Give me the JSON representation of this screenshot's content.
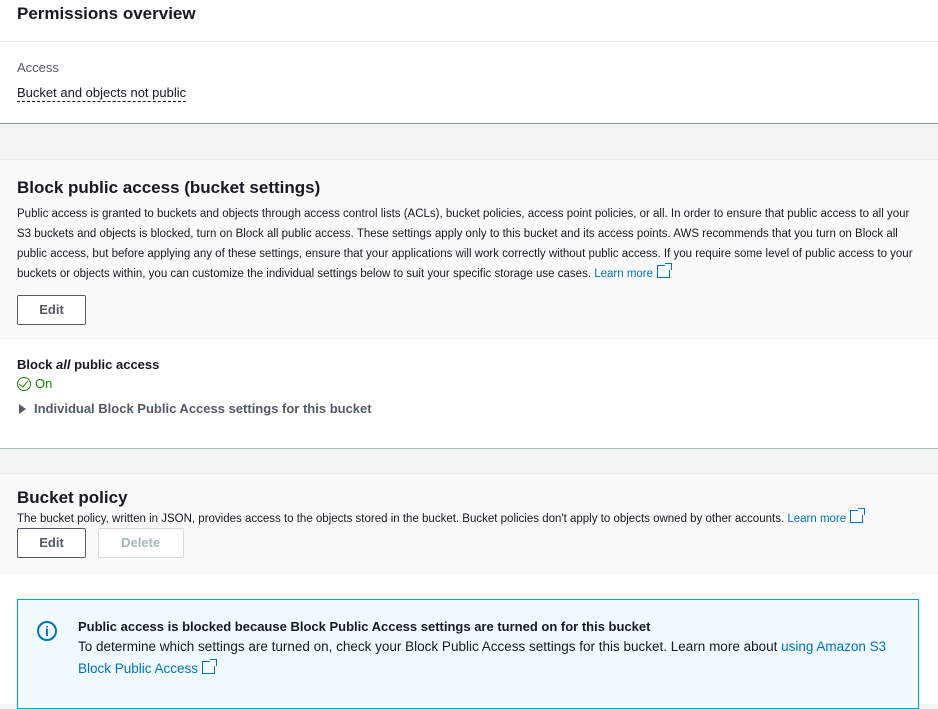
{
  "permissions": {
    "title": "Permissions overview",
    "access_label": "Access",
    "access_value": "Bucket and objects not public"
  },
  "bpa": {
    "title": "Block public access (bucket settings)",
    "description": "Public access is granted to buckets and objects through access control lists (ACLs), bucket policies, access point policies, or all. In order to ensure that public access to all your S3 buckets and objects is blocked, turn on Block all public access. These settings apply only to this bucket and its access points. AWS recommends that you turn on Block all public access, but before applying any of these settings, ensure that your applications will work correctly without public access. If you require some level of public access to your buckets or objects within, you can customize the individual settings below to suit your specific storage use cases.",
    "learn_more": "Learn more",
    "edit_label": "Edit",
    "block_all_prefix": "Block ",
    "block_all_em": "all",
    "block_all_suffix": " public access",
    "status": "On",
    "expander": "Individual Block Public Access settings for this bucket"
  },
  "policy": {
    "title": "Bucket policy",
    "description": "The bucket policy, written in JSON, provides access to the objects stored in the bucket. Bucket policies don't apply to objects owned by other accounts.",
    "learn_more": "Learn more",
    "edit_label": "Edit",
    "delete_label": "Delete"
  },
  "alert": {
    "heading": "Public access is blocked because Block Public Access settings are turned on for this bucket",
    "body": "To determine which settings are turned on, check your Block Public Access settings for this bucket. Learn more about",
    "link": "using Amazon S3 Block Public Access",
    "icon": "info-icon"
  },
  "colors": {
    "link": "#0073bb",
    "success": "#1d8102",
    "info_border": "#00a1c9"
  }
}
